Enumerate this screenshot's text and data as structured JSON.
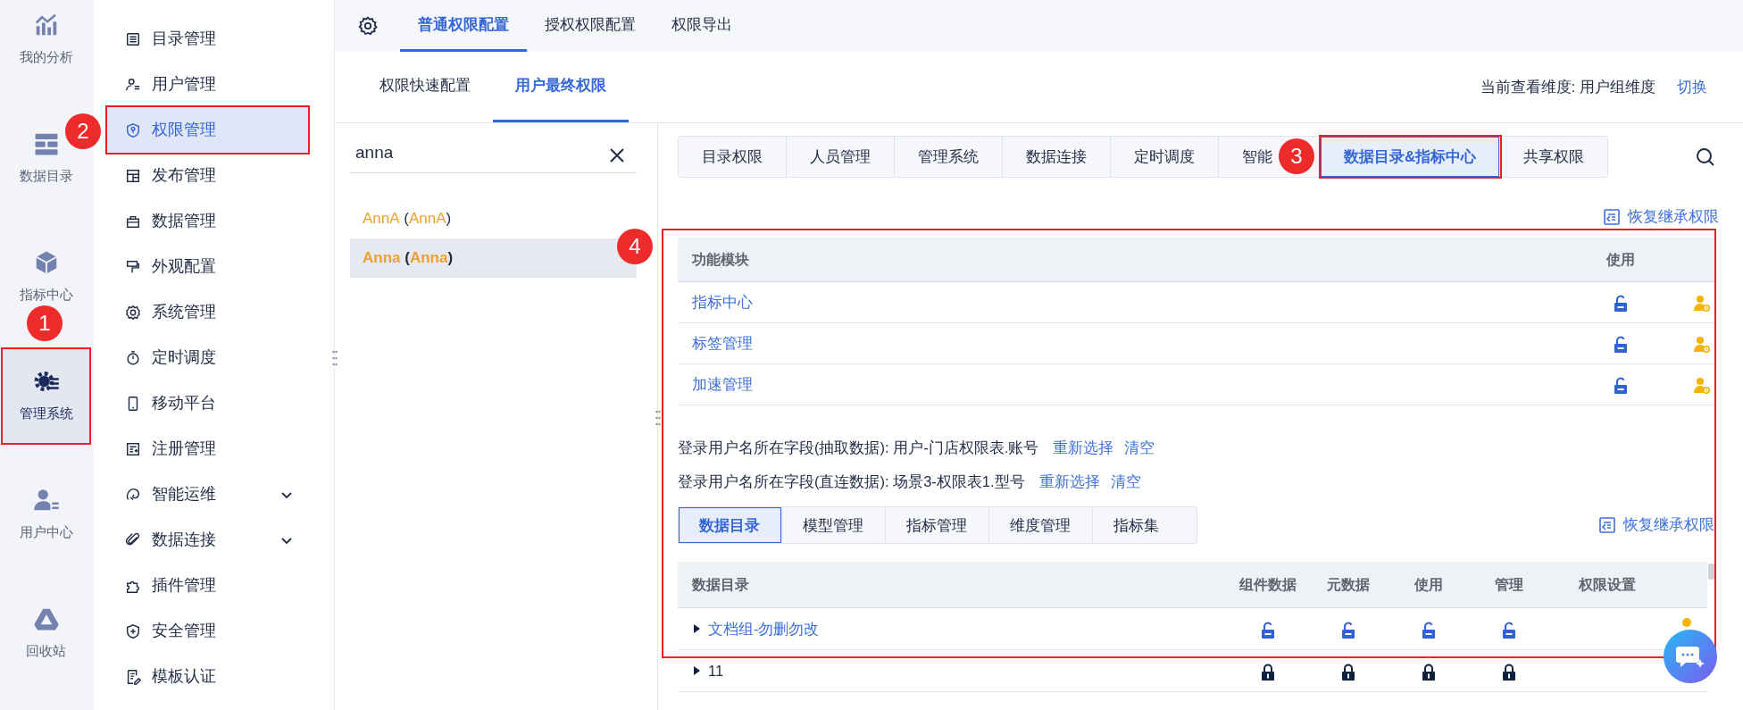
{
  "rail": [
    {
      "label": "我的分析",
      "selected": false
    },
    {
      "label": "数据目录",
      "selected": false
    },
    {
      "label": "指标中心",
      "selected": false
    },
    {
      "label": "管理系统",
      "selected": true,
      "callout": "1"
    },
    {
      "label": "用户中心",
      "selected": false
    },
    {
      "label": "回收站",
      "selected": false
    }
  ],
  "menu": [
    {
      "label": "目录管理",
      "kind": "page",
      "selected": false
    },
    {
      "label": "用户管理",
      "kind": "page",
      "selected": false
    },
    {
      "label": "权限管理",
      "kind": "page",
      "selected": true,
      "callout": "2"
    },
    {
      "label": "发布管理",
      "kind": "page",
      "selected": false
    },
    {
      "label": "数据管理",
      "kind": "page",
      "selected": false
    },
    {
      "label": "外观配置",
      "kind": "page",
      "selected": false
    },
    {
      "label": "系统管理",
      "kind": "page",
      "selected": false
    },
    {
      "label": "定时调度",
      "kind": "page",
      "selected": false
    },
    {
      "label": "移动平台",
      "kind": "page",
      "selected": false
    },
    {
      "label": "注册管理",
      "kind": "page",
      "selected": false
    },
    {
      "label": "智能运维",
      "kind": "group",
      "selected": false
    },
    {
      "label": "数据连接",
      "kind": "group",
      "selected": false
    },
    {
      "label": "插件管理",
      "kind": "page",
      "selected": false
    },
    {
      "label": "安全管理",
      "kind": "page",
      "selected": false
    },
    {
      "label": "模板认证",
      "kind": "page",
      "selected": false
    }
  ],
  "top_tabs": [
    {
      "label": "普通权限配置",
      "selected": true
    },
    {
      "label": "授权权限配置",
      "selected": false
    },
    {
      "label": "权限导出",
      "selected": false
    }
  ],
  "sub_tabs": [
    {
      "label": "权限快速配置",
      "selected": false
    },
    {
      "label": "用户最终权限",
      "selected": true
    }
  ],
  "view_dimension": {
    "label": "当前查看维度:  用户组维度",
    "action": "切换"
  },
  "search": {
    "value": "anna"
  },
  "users": [
    {
      "selected": false,
      "segments": [
        {
          "text": "AnnA",
          "match": true
        },
        {
          "text": " (",
          "match": false
        },
        {
          "text": "AnnA",
          "match": true
        },
        {
          "text": ")",
          "match": false
        }
      ]
    },
    {
      "selected": true,
      "segments": [
        {
          "text": "Anna",
          "match": true
        },
        {
          "text": " (",
          "match": false
        },
        {
          "text": "Anna",
          "match": true
        },
        {
          "text": ")",
          "match": false
        }
      ]
    }
  ],
  "permission_tabs": [
    {
      "label": "目录权限",
      "selected": false
    },
    {
      "label": "人员管理",
      "selected": false
    },
    {
      "label": "管理系统",
      "selected": false
    },
    {
      "label": "数据连接",
      "selected": false
    },
    {
      "label": "定时调度",
      "selected": false
    },
    {
      "label": "智能",
      "selected": false
    },
    {
      "label": "数据目录&指标中心",
      "selected": true,
      "callout": "3"
    },
    {
      "label": "共享权限",
      "selected": false
    }
  ],
  "restore_link": "恢复继承权限",
  "detail_panel": {
    "callout": "4",
    "module_table": {
      "columns": [
        "功能模块",
        "使用"
      ],
      "rows": [
        {
          "name": "指标中心",
          "locked": false
        },
        {
          "name": "标签管理",
          "locked": false
        },
        {
          "name": "加速管理",
          "locked": false
        }
      ]
    },
    "login_fields": [
      {
        "text": "登录用户名所在字段(抽取数据): 用户-门店权限表.账号",
        "actions": [
          "重新选择",
          "清空"
        ]
      },
      {
        "text": "登录用户名所在字段(直连数据): 场景3-权限表1.型号",
        "actions": [
          "重新选择",
          "清空"
        ]
      }
    ],
    "catalog_tabs": [
      {
        "label": "数据目录",
        "selected": true
      },
      {
        "label": "模型管理",
        "selected": false
      },
      {
        "label": "指标管理",
        "selected": false
      },
      {
        "label": "维度管理",
        "selected": false
      },
      {
        "label": "指标集",
        "selected": false
      }
    ],
    "restore_link": "恢复继承权限",
    "catalog_table": {
      "columns": [
        "数据目录",
        "组件数据",
        "元数据",
        "使用",
        "管理",
        "权限设置"
      ],
      "rows": [
        {
          "name": "文档组-勿删勿改",
          "linked": true,
          "expanded": false,
          "settings": true,
          "cells": [
            {
              "locked": false
            },
            {
              "locked": false
            },
            {
              "locked": false
            },
            {
              "locked": false
            }
          ]
        },
        {
          "name": "11",
          "linked": false,
          "expanded": false,
          "cells": [
            {
              "locked": true
            },
            {
              "locked": true
            },
            {
              "locked": true
            },
            {
              "locked": true
            }
          ]
        }
      ]
    }
  }
}
